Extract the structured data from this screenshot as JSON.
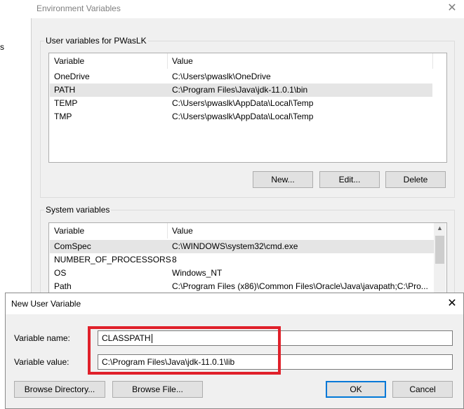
{
  "background": {
    "partial_text": "s"
  },
  "env_dialog": {
    "title": "Environment Variables",
    "user_group_label": "User variables for PWasLK",
    "user_columns": [
      "Variable",
      "Value"
    ],
    "user_rows": [
      {
        "variable": "OneDrive",
        "value": "C:\\Users\\pwaslk\\OneDrive"
      },
      {
        "variable": "PATH",
        "value": "C:\\Program Files\\Java\\jdk-11.0.1\\bin"
      },
      {
        "variable": "TEMP",
        "value": "C:\\Users\\pwaslk\\AppData\\Local\\Temp"
      },
      {
        "variable": "TMP",
        "value": "C:\\Users\\pwaslk\\AppData\\Local\\Temp"
      }
    ],
    "user_buttons": {
      "new": "New...",
      "edit": "Edit...",
      "delete": "Delete"
    },
    "system_group_label": "System variables",
    "system_columns": [
      "Variable",
      "Value"
    ],
    "system_rows": [
      {
        "variable": "ComSpec",
        "value": "C:\\WINDOWS\\system32\\cmd.exe"
      },
      {
        "variable": "NUMBER_OF_PROCESSORS",
        "value": "8"
      },
      {
        "variable": "OS",
        "value": "Windows_NT"
      },
      {
        "variable": "Path",
        "value": "C:\\Program Files (x86)\\Common Files\\Oracle\\Java\\javapath;C:\\Pro..."
      }
    ]
  },
  "new_dialog": {
    "title": "New User Variable",
    "name_label": "Variable name:",
    "name_value": "CLASSPATH",
    "value_label": "Variable value:",
    "value_value": "C:\\Program Files\\Java\\jdk-11.0.1\\lib",
    "browse_directory": "Browse Directory...",
    "browse_file": "Browse File...",
    "ok": "OK",
    "cancel": "Cancel"
  },
  "colors": {
    "highlight_box": "#e0202a",
    "dialog_bg": "#f0f0f0",
    "default_button_border": "#0078d7"
  },
  "icons": {
    "close": "close-icon"
  }
}
